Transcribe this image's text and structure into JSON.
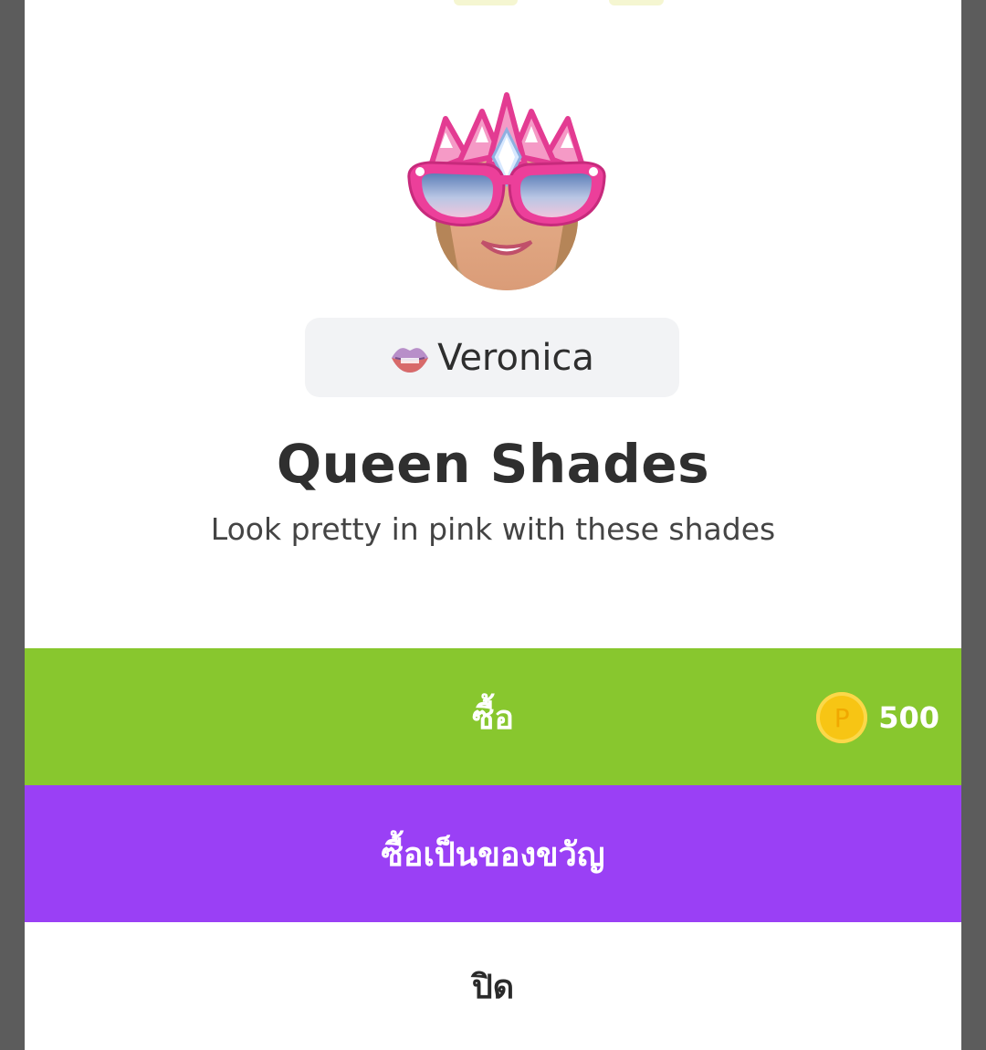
{
  "profile": {
    "username": "Veronica"
  },
  "item": {
    "title": "Queen Shades",
    "description": "Look pretty in pink with these shades"
  },
  "actions": {
    "buy_label": "ซื้อ",
    "price": "500",
    "coin_symbol": "P",
    "gift_label": "ซื้อเป็นของขวัญ",
    "close_label": "ปิด"
  },
  "colors": {
    "buy": "#88c72e",
    "gift": "#9a40f5",
    "coin": "#f7c514",
    "frame_pink": "#ec3f9a"
  },
  "icons": {
    "avatar": "queen-shades-avatar-icon",
    "user_badge": "lips-icon",
    "coin": "coin-icon"
  }
}
